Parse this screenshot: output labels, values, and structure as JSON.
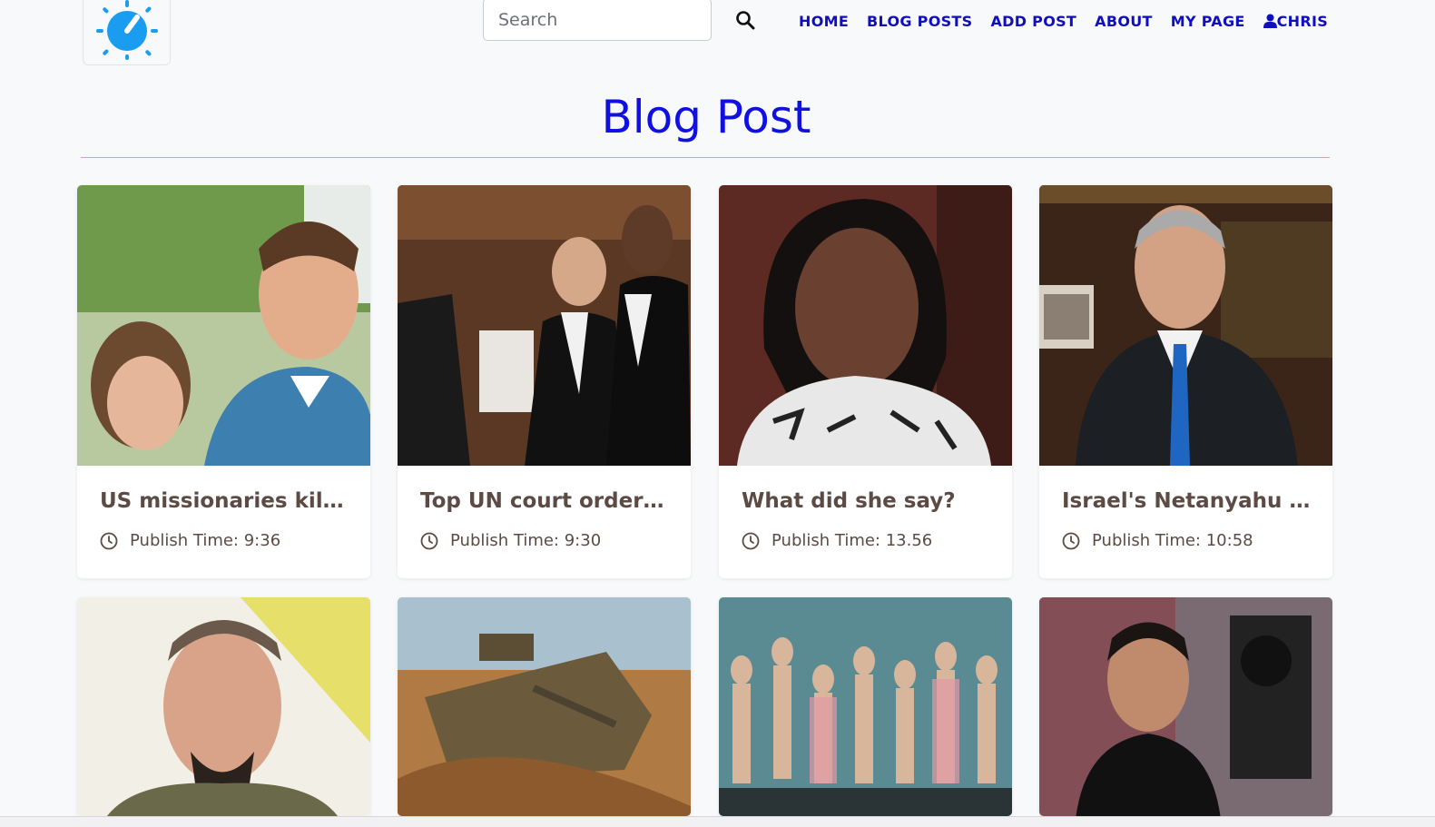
{
  "header": {
    "logo_icon": "dial-logo-icon",
    "search": {
      "placeholder": "Search",
      "value": ""
    },
    "search_icon": "search-icon",
    "nav": [
      {
        "label": "HOME"
      },
      {
        "label": "BLOG POSTS"
      },
      {
        "label": "ADD POST"
      },
      {
        "label": "ABOUT"
      },
      {
        "label": "MY PAGE"
      },
      {
        "label": "CHRIS",
        "icon": "user-icon"
      }
    ],
    "nav_color": "#0f0fbf"
  },
  "main": {
    "page_title": "Blog Post",
    "title_color": "#1010e0",
    "rule_color": "#d5b555",
    "time_label": "Publish Time: ",
    "posts": [
      {
        "title": "US missionaries kille...",
        "publish_time": "9:36"
      },
      {
        "title": "Top UN court orders ...",
        "publish_time": "9:30"
      },
      {
        "title": "What did she say?",
        "publish_time": "13.56"
      },
      {
        "title": "Israel's Netanyahu t...",
        "publish_time": "10:58"
      }
    ],
    "clock_icon": "clock-icon"
  }
}
